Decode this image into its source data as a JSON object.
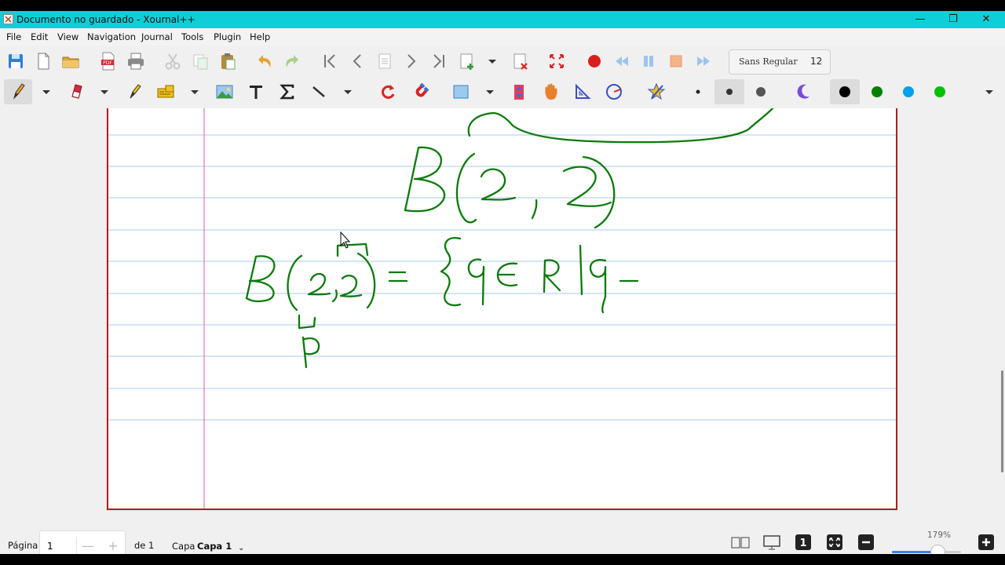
{
  "window": {
    "title": "Documento no guardado - Xournal++",
    "controls": {
      "minimize": "—",
      "restore": "❐",
      "close": "✕"
    }
  },
  "menu": [
    "File",
    "Edit",
    "View",
    "Navigation",
    "Journal",
    "Tools",
    "Plugin",
    "Help"
  ],
  "toolbar1": {
    "icons": [
      "save-icon",
      "new-document-icon",
      "open-icon",
      "export-pdf-icon",
      "print-icon",
      "cut-icon",
      "copy-icon",
      "paste-icon",
      "undo-icon",
      "redo-icon",
      "goto-first-page-icon",
      "previous-page-icon",
      "goto-page-icon",
      "next-page-icon",
      "goto-last-page-icon",
      "insert-page-icon",
      "delete-page-icon",
      "fullscreen-icon",
      "record-icon",
      "rewind-icon",
      "pause-icon",
      "stop-icon",
      "fast-forward-icon"
    ],
    "font_name": "Sans Regular",
    "font_size": "12"
  },
  "toolbar2": {
    "icons": [
      "pen-icon",
      "eraser-icon",
      "highlighter-icon",
      "text-tool-icon",
      "image-icon",
      "text-icon",
      "math-sigma-icon",
      "line-icon",
      "rotation-snapping-icon",
      "magnet-icon",
      "shape-rectangle-icon",
      "vertical-space-icon",
      "hand-icon",
      "setsquare-icon",
      "compass-icon",
      "shape-recognizer-icon",
      "thin-dot-icon",
      "medium-dot-icon",
      "thick-dot-icon",
      "fill-icon"
    ],
    "colors": [
      "#000000",
      "#008000",
      "#00a2e8",
      "#00c000"
    ],
    "active_color": "#000000"
  },
  "document": {
    "pen_color": "#0a7a0a",
    "margin_line_color": "#e67ec0",
    "rule_line_color": "#a9c8ee"
  },
  "status": {
    "page_label": "Página",
    "page_value": "1",
    "of_label": "de 1",
    "layer_label": "Capa",
    "layer_value": "Capa 1",
    "zoom": "179%",
    "zoom_fraction": 0.66
  }
}
